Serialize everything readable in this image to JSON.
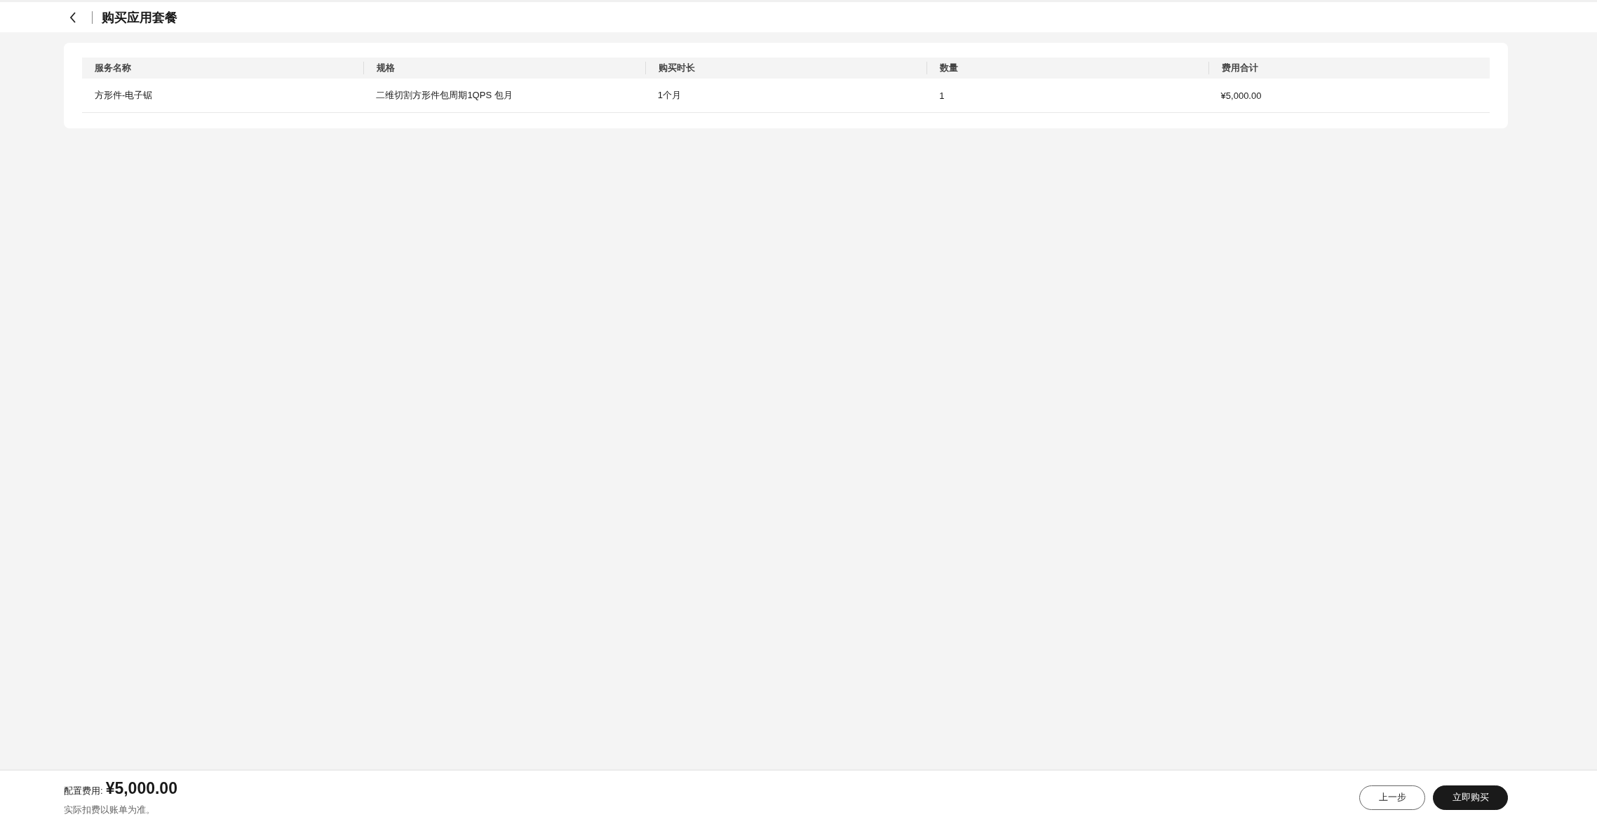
{
  "header": {
    "title": "购买应用套餐"
  },
  "table": {
    "columns": [
      "服务名称",
      "规格",
      "购买时长",
      "数量",
      "费用合计"
    ],
    "rows": [
      [
        "方形件-电子锯",
        "二维切割方形件包周期1QPS 包月",
        "1个月",
        "1",
        "¥5,000.00"
      ]
    ]
  },
  "footer": {
    "price_label": "配置费用:",
    "price": "¥5,000.00",
    "note": "实际扣费以账单为准。",
    "buttons": [
      {
        "label": "上一步",
        "kind": "secondary"
      },
      {
        "label": "立即购买",
        "kind": "primary"
      }
    ]
  }
}
